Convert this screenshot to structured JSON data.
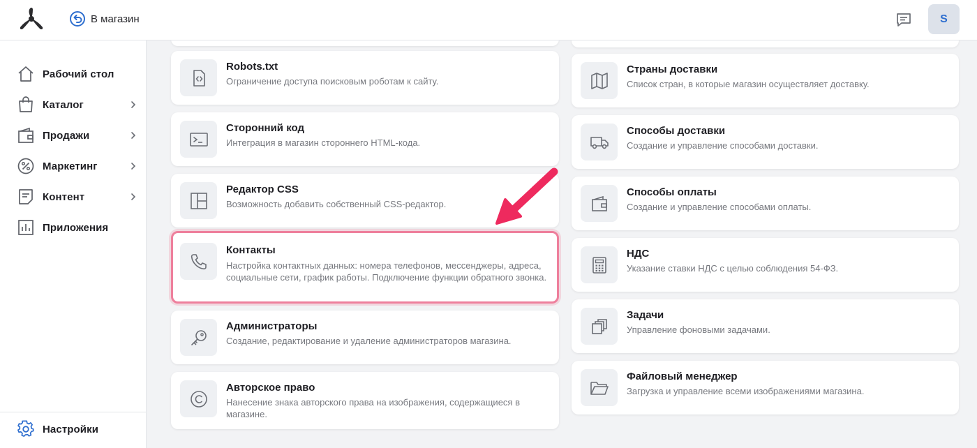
{
  "topbar": {
    "back_label": "В магазин",
    "avatar_letter": "S"
  },
  "sidebar": {
    "items": [
      {
        "label": "Рабочий стол",
        "icon": "home-icon"
      },
      {
        "label": "Каталог",
        "icon": "bag-icon"
      },
      {
        "label": "Продажи",
        "icon": "wallet-icon"
      },
      {
        "label": "Маркетинг",
        "icon": "percent-icon"
      },
      {
        "label": "Контент",
        "icon": "document-icon"
      },
      {
        "label": "Приложения",
        "icon": "chart-icon"
      }
    ],
    "settings_label": "Настройки"
  },
  "left_cards": [
    {
      "title": "Robots.txt",
      "desc": "Ограничение доступа поисковым роботам к сайту.",
      "icon": "code-file-icon"
    },
    {
      "title": "Сторонний код",
      "desc": "Интеграция в магазин стороннего HTML-кода.",
      "icon": "terminal-icon"
    },
    {
      "title": "Редактор CSS",
      "desc": "Возможность добавить собственный CSS-редактор.",
      "icon": "layout-icon"
    },
    {
      "title": "Контакты",
      "desc": "Настройка контактных данных: номера телефонов, мессенджеры, адреса, социальные сети, график работы. Подключение функции обратного звонка.",
      "icon": "phone-icon"
    },
    {
      "title": "Администраторы",
      "desc": "Создание, редактирование и удаление администраторов магазина.",
      "icon": "key-icon"
    },
    {
      "title": "Авторское право",
      "desc": "Нанесение знака авторского права на изображения, содержащиеся в магазине.",
      "icon": "copyright-icon"
    }
  ],
  "right_cards": [
    {
      "title": "Страны доставки",
      "desc": "Список стран, в которые магазин осуществляет доставку.",
      "icon": "map-icon"
    },
    {
      "title": "Способы доставки",
      "desc": "Создание и управление способами доставки.",
      "icon": "truck-icon"
    },
    {
      "title": "Способы оплаты",
      "desc": "Создание и управление способами оплаты.",
      "icon": "wallet-icon"
    },
    {
      "title": "НДС",
      "desc": "Указание ставки НДС с целью соблюдения 54-ФЗ.",
      "icon": "calculator-icon"
    },
    {
      "title": "Задачи",
      "desc": "Управление фоновыми задачами.",
      "icon": "copy-icon"
    },
    {
      "title": "Файловый менеджер",
      "desc": "Загрузка и управление всеми изображениями магазина.",
      "icon": "folder-icon"
    }
  ],
  "colors": {
    "accent_blue": "#2f6fcf",
    "highlight_pink": "#ee7f9c",
    "arrow_red": "#ee2a5e"
  }
}
